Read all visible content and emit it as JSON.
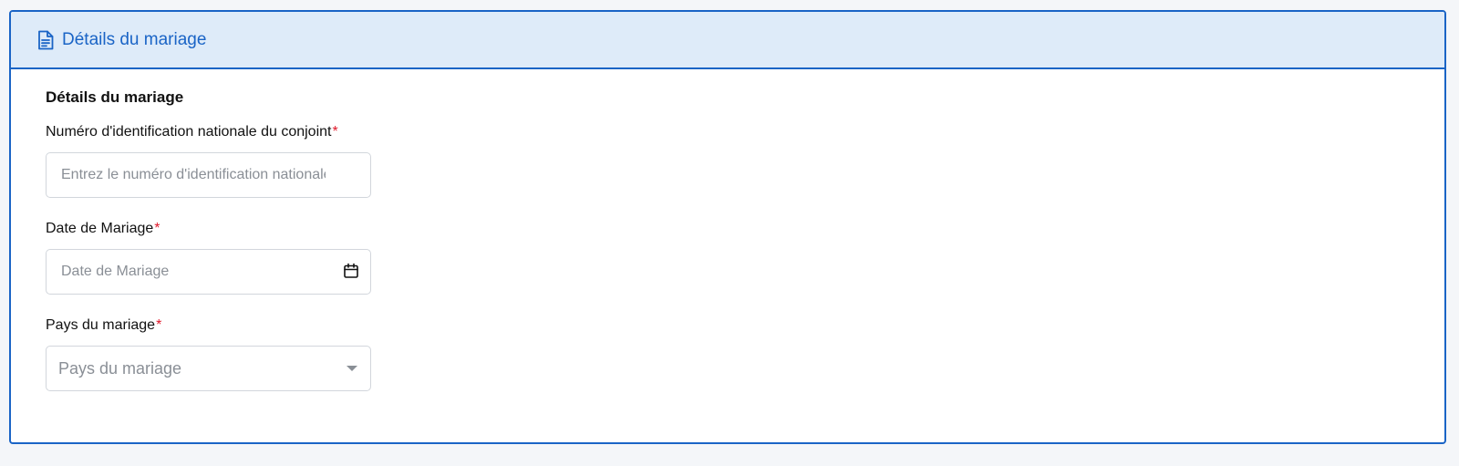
{
  "header": {
    "title": "Détails du mariage",
    "icon": "file-text-icon",
    "accent_color": "#1a64c6",
    "background_color": "#deebf9"
  },
  "section": {
    "title": "Détails du mariage"
  },
  "fields": {
    "spouse_id": {
      "label": "Numéro d'identification nationale du conjoint",
      "required_mark": "*",
      "placeholder": "Entrez le numéro d'identification nationale",
      "value": ""
    },
    "marriage_date": {
      "label": "Date de Mariage",
      "required_mark": "*",
      "placeholder": "Date de Mariage",
      "value": "",
      "icon": "calendar-icon"
    },
    "marriage_country": {
      "label": "Pays du mariage",
      "required_mark": "*",
      "placeholder": "Pays du mariage",
      "icon": "chevron-down-icon"
    }
  }
}
